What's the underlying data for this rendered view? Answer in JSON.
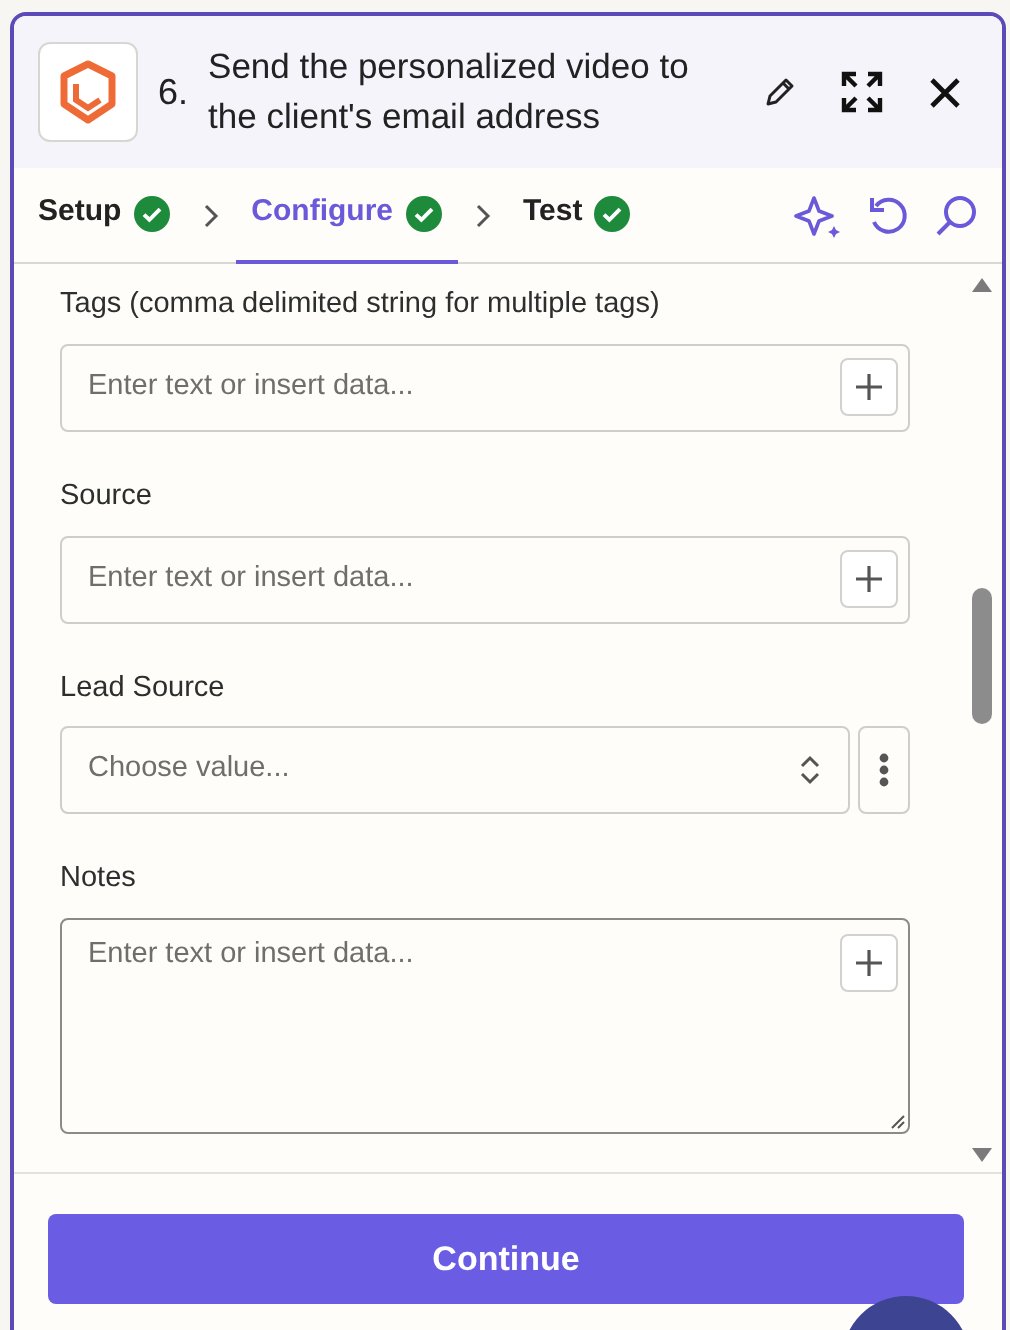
{
  "header": {
    "step_number": "6.",
    "title": "Send the personalized video to the client's email address"
  },
  "tabs": [
    {
      "label": "Setup",
      "selected": false,
      "complete": true
    },
    {
      "label": "Configure",
      "selected": true,
      "complete": true
    },
    {
      "label": "Test",
      "selected": false,
      "complete": true
    }
  ],
  "fields": [
    {
      "kind": "text",
      "label": "Tags (comma delimited string for multiple tags)",
      "placeholder": "Enter text or insert data..."
    },
    {
      "kind": "text",
      "label": "Source",
      "placeholder": "Enter text or insert data..."
    },
    {
      "kind": "select",
      "label": "Lead Source",
      "placeholder": "Choose value..."
    },
    {
      "kind": "textarea",
      "label": "Notes",
      "placeholder": "Enter text or insert data..."
    }
  ],
  "footer": {
    "button": "Continue"
  }
}
